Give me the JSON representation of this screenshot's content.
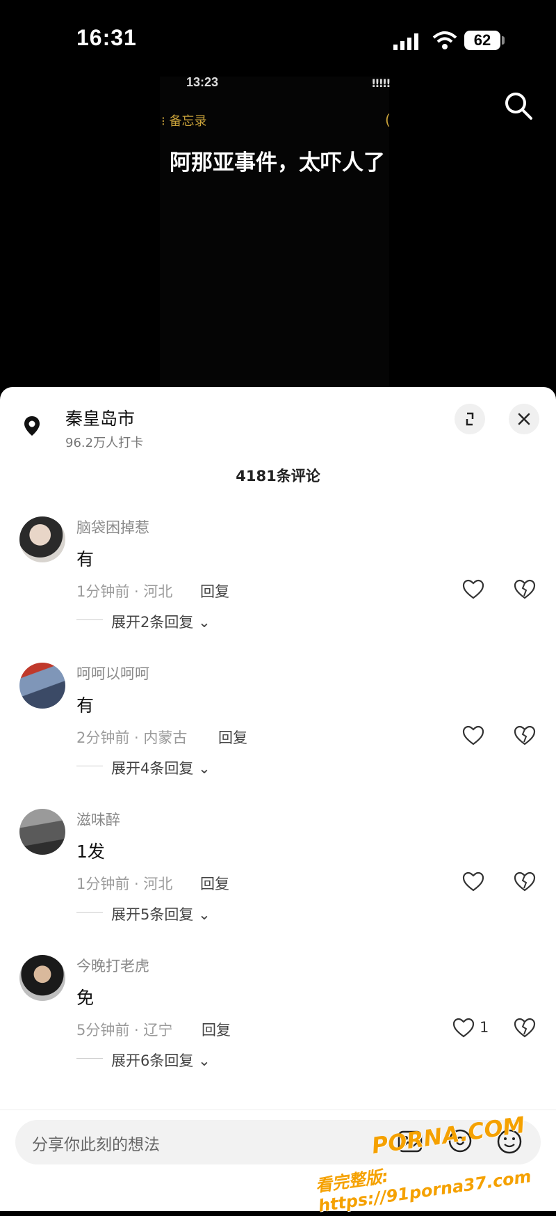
{
  "status_bar": {
    "time": "16:31",
    "battery": "62"
  },
  "video": {
    "inner_time": "13:23",
    "inner_signal": "!!!!!",
    "memo_label": "⁝ 备忘录",
    "caption": "阿那亚事件，太吓人了"
  },
  "sheet": {
    "location_name": "秦皇岛市",
    "location_sub": "96.2万人打卡",
    "comment_count": "4181条评论",
    "comments": [
      {
        "user": "脑袋困掉惹",
        "text": "有",
        "meta": "1分钟前 · 河北",
        "reply": "回复",
        "likes": "",
        "expand": "展开2条回复"
      },
      {
        "user": "呵呵以呵呵",
        "text": "有",
        "meta": "2分钟前 · 内蒙古",
        "reply": "回复",
        "likes": "",
        "expand": "展开4条回复"
      },
      {
        "user": "滋味醉",
        "text": "1发",
        "meta": "1分钟前 · 河北",
        "reply": "回复",
        "likes": "",
        "expand": "展开5条回复"
      },
      {
        "user": "今晚打老虎",
        "text": "免",
        "meta": "5分钟前 · 辽宁",
        "reply": "回复",
        "likes": "1",
        "expand": "展开6条回复"
      }
    ]
  },
  "input": {
    "placeholder": "分享你此刻的想法"
  },
  "watermark": {
    "brand": "PORNA.COM",
    "url": "看完整版: https://91porna37.com"
  },
  "icons": [
    "signal-icon",
    "wifi-icon",
    "search-icon",
    "location-pin-icon",
    "expand-icon",
    "close-icon",
    "heart-icon",
    "broken-heart-icon",
    "chevron-down-icon",
    "image-icon",
    "at-icon",
    "emoji-icon"
  ]
}
